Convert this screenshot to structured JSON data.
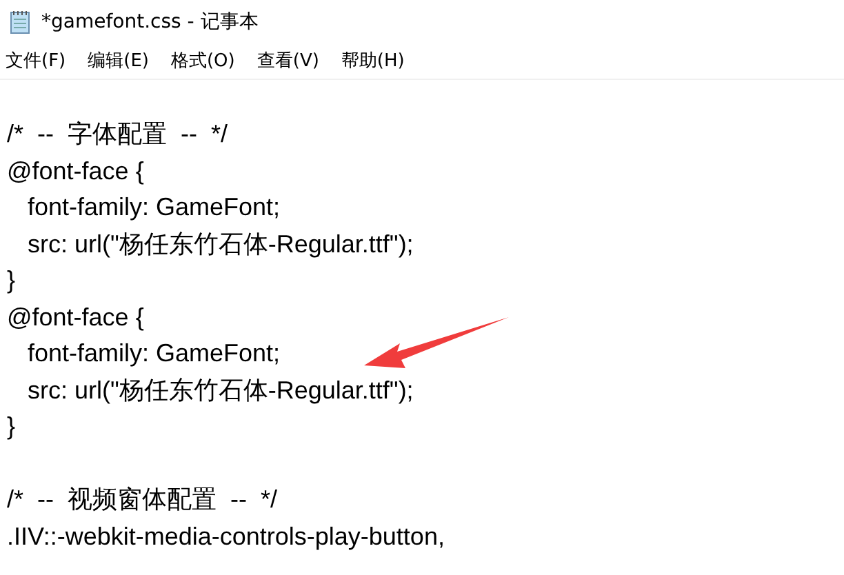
{
  "window": {
    "title": "*gamefont.css - 记事本"
  },
  "menu": [
    "文件(F)",
    "编辑(E)",
    "格式(O)",
    "查看(V)",
    "帮助(H)"
  ],
  "editor": {
    "lines": [
      {
        "kind": "blank"
      },
      {
        "kind": "code",
        "text": "/*  --  字体配置  --  */"
      },
      {
        "kind": "code",
        "text": "@font-face {"
      },
      {
        "kind": "code",
        "text": "   font-family: GameFont;"
      },
      {
        "kind": "code",
        "text": "   src: url(\"杨任东竹石体-Regular.ttf\");"
      },
      {
        "kind": "code",
        "text": "}"
      },
      {
        "kind": "code",
        "text": "@font-face {"
      },
      {
        "kind": "code",
        "text": "   font-family: GameFont;"
      },
      {
        "kind": "code",
        "text": "   src: url(\"杨任东竹石体-Regular.ttf\");"
      },
      {
        "kind": "code",
        "text": "}"
      },
      {
        "kind": "blank"
      },
      {
        "kind": "code",
        "text": "/*  --  视频窗体配置  --  */"
      },
      {
        "kind": "code",
        "text": ".IIV::-webkit-media-controls-play-button,"
      }
    ]
  }
}
